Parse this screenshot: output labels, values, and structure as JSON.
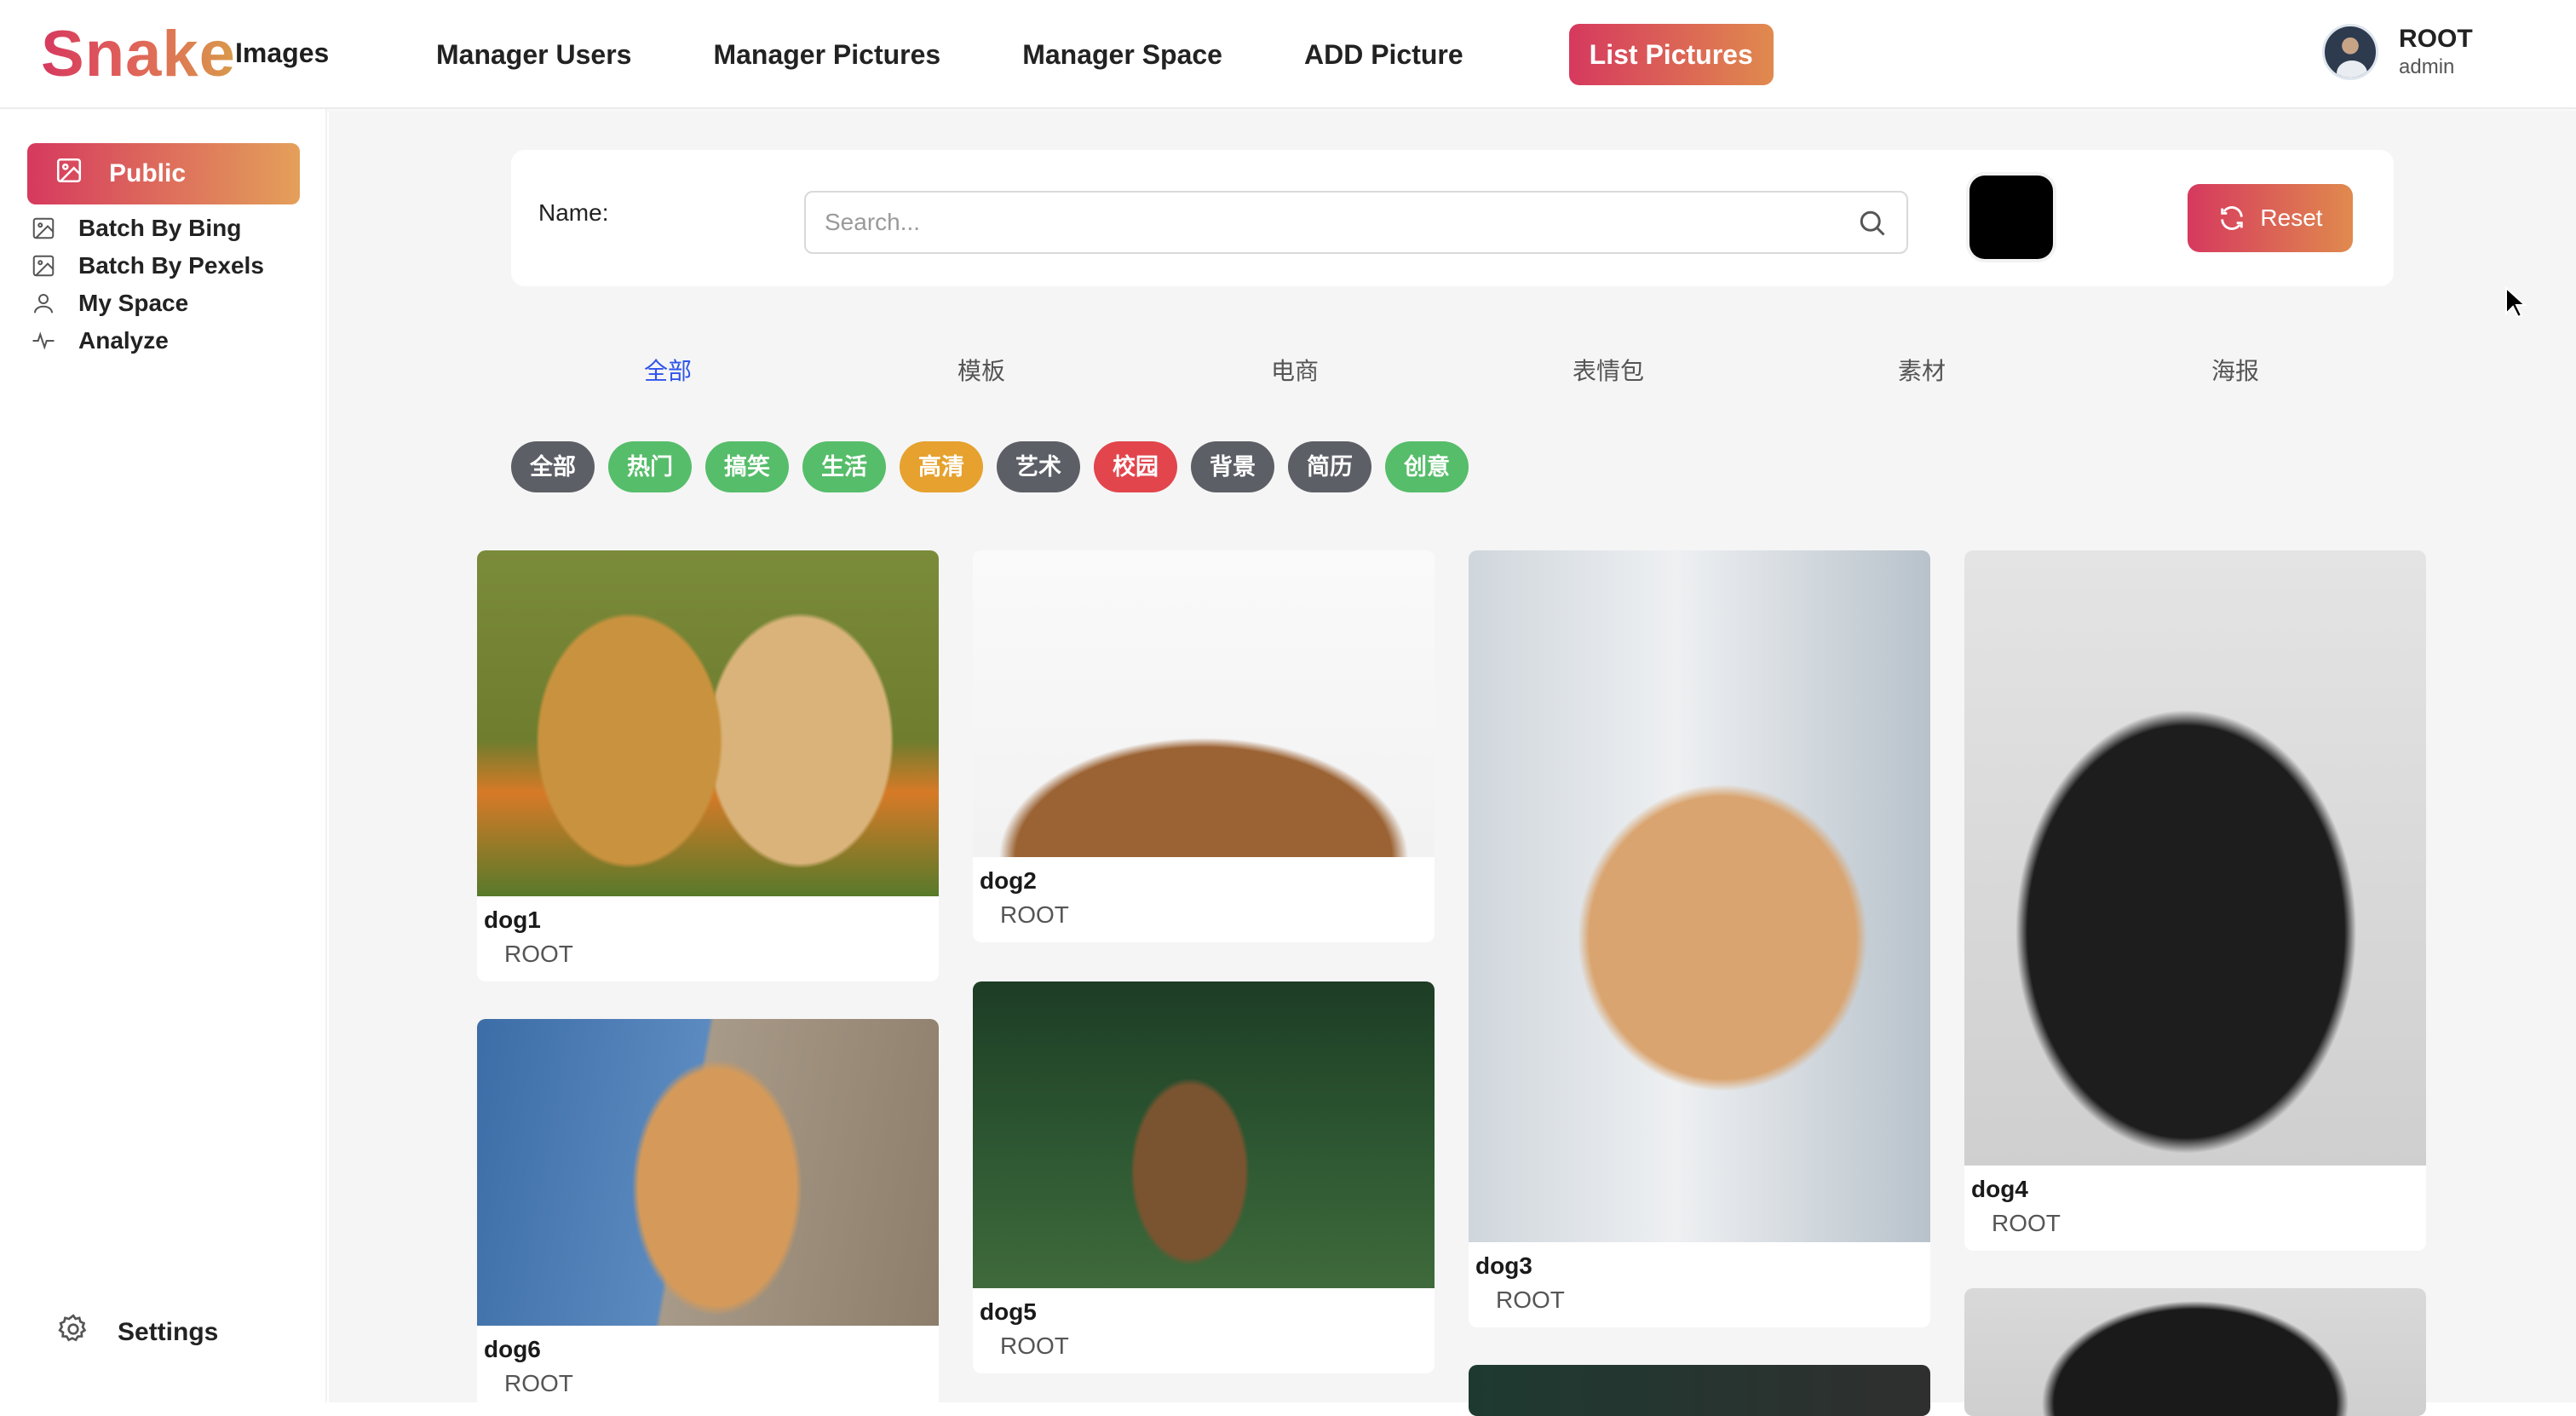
{
  "app": {
    "logo": "Snake",
    "logo_sub": "Images"
  },
  "nav": {
    "items": [
      "Manager Users",
      "Manager Pictures",
      "Manager Space",
      "ADD Picture",
      "List Pictures"
    ],
    "active": "List Pictures"
  },
  "user": {
    "name": "ROOT",
    "role": "admin"
  },
  "sidebar": {
    "public": "Public",
    "items": [
      {
        "label": "Batch By Bing",
        "icon": "image-icon"
      },
      {
        "label": "Batch By Pexels",
        "icon": "image-icon"
      },
      {
        "label": "My Space",
        "icon": "user-icon"
      },
      {
        "label": "Analyze",
        "icon": "pulse-icon"
      }
    ],
    "settings": "Settings"
  },
  "search": {
    "label": "Name:",
    "placeholder": "Search...",
    "color_value": "#000000",
    "reset_label": "Reset"
  },
  "categories": [
    "全部",
    "模板",
    "电商",
    "表情包",
    "素材",
    "海报"
  ],
  "active_category": "全部",
  "tags": [
    {
      "label": "全部",
      "color": "#5c5f66"
    },
    {
      "label": "热门",
      "color": "#56bd6a"
    },
    {
      "label": "搞笑",
      "color": "#56bd6a"
    },
    {
      "label": "生活",
      "color": "#56bd6a"
    },
    {
      "label": "高清",
      "color": "#e6a12e"
    },
    {
      "label": "艺术",
      "color": "#5c5f66"
    },
    {
      "label": "校园",
      "color": "#e2454c"
    },
    {
      "label": "背景",
      "color": "#5c5f66"
    },
    {
      "label": "简历",
      "color": "#5c5f66"
    },
    {
      "label": "创意",
      "color": "#56bd6a"
    }
  ],
  "pictures": [
    {
      "title": "dog1",
      "owner": "ROOT"
    },
    {
      "title": "dog2",
      "owner": "ROOT"
    },
    {
      "title": "dog3",
      "owner": "ROOT"
    },
    {
      "title": "dog4",
      "owner": "ROOT"
    },
    {
      "title": "dog6",
      "owner": "ROOT"
    },
    {
      "title": "dog5",
      "owner": "ROOT"
    }
  ],
  "colors": {
    "accent_start": "#d6395e",
    "accent_end": "#e08a4e",
    "active_tab": "#2f54eb"
  }
}
